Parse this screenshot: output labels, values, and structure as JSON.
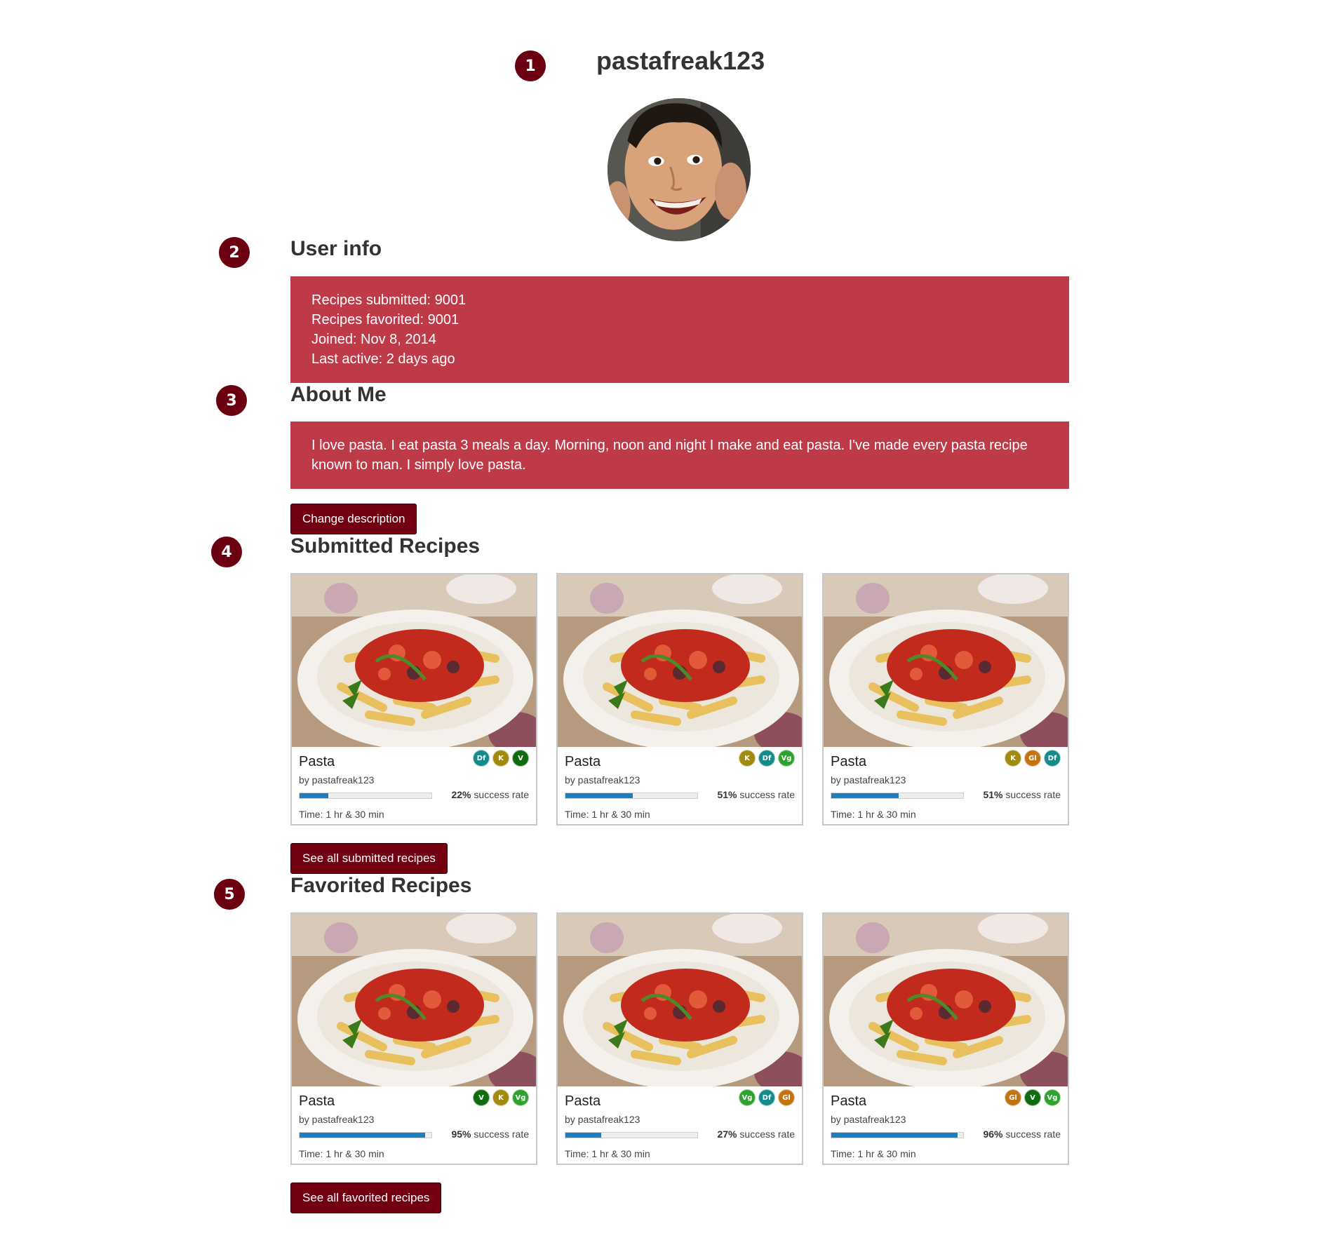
{
  "profile": {
    "username": "pastafreak123"
  },
  "markers": [
    "1",
    "2",
    "3",
    "4",
    "5"
  ],
  "user_info": {
    "heading": "User info",
    "lines": [
      "Recipes submitted: 9001",
      "Recipes favorited: 9001",
      "Joined: Nov 8, 2014",
      "Last active: 2 days ago"
    ]
  },
  "about": {
    "heading": "About Me",
    "text": "I love pasta. I eat pasta 3 meals a day. Morning, noon and night I make and eat pasta. I've made every pasta recipe known to man. I simply love pasta.",
    "change_button": "Change description"
  },
  "submitted": {
    "heading": "Submitted Recipes",
    "see_all": "See all submitted recipes",
    "cards": [
      {
        "title": "Pasta",
        "by": "by pastafreak123",
        "rate_pct": "22%",
        "rate_text": " success rate",
        "rate": 0.22,
        "time": "Time: 1 hr & 30 min",
        "badges": [
          {
            "label": "Df",
            "color": "#148a8a"
          },
          {
            "label": "K",
            "color": "#a08a10"
          },
          {
            "label": "V",
            "color": "#0e6b0e"
          }
        ]
      },
      {
        "title": "Pasta",
        "by": "by pastafreak123",
        "rate_pct": "51%",
        "rate_text": " success rate",
        "rate": 0.51,
        "time": "Time: 1 hr & 30 min",
        "badges": [
          {
            "label": "K",
            "color": "#a08a10"
          },
          {
            "label": "Df",
            "color": "#148a8a"
          },
          {
            "label": "Vg",
            "color": "#2ea12e"
          }
        ]
      },
      {
        "title": "Pasta",
        "by": "by pastafreak123",
        "rate_pct": "51%",
        "rate_text": " success rate",
        "rate": 0.51,
        "time": "Time: 1 hr & 30 min",
        "badges": [
          {
            "label": "K",
            "color": "#a08a10"
          },
          {
            "label": "Gl",
            "color": "#c27413"
          },
          {
            "label": "Df",
            "color": "#148a8a"
          }
        ]
      }
    ]
  },
  "favorited": {
    "heading": "Favorited Recipes",
    "see_all": "See all favorited recipes",
    "cards": [
      {
        "title": "Pasta",
        "by": "by pastafreak123",
        "rate_pct": "95%",
        "rate_text": " success rate",
        "rate": 0.95,
        "time": "Time: 1 hr & 30 min",
        "badges": [
          {
            "label": "V",
            "color": "#0e6b0e"
          },
          {
            "label": "K",
            "color": "#a08a10"
          },
          {
            "label": "Vg",
            "color": "#2ea12e"
          }
        ]
      },
      {
        "title": "Pasta",
        "by": "by pastafreak123",
        "rate_pct": "27%",
        "rate_text": " success rate",
        "rate": 0.27,
        "time": "Time: 1 hr & 30 min",
        "badges": [
          {
            "label": "Vg",
            "color": "#2ea12e"
          },
          {
            "label": "Df",
            "color": "#148a8a"
          },
          {
            "label": "Gl",
            "color": "#c27413"
          }
        ]
      },
      {
        "title": "Pasta",
        "by": "by pastafreak123",
        "rate_pct": "96%",
        "rate_text": " success rate",
        "rate": 0.96,
        "time": "Time: 1 hr & 30 min",
        "badges": [
          {
            "label": "Gl",
            "color": "#c27413"
          },
          {
            "label": "V",
            "color": "#0e6b0e"
          },
          {
            "label": "Vg",
            "color": "#2ea12e"
          }
        ]
      }
    ]
  },
  "colors": {
    "accent": "#730010",
    "info_background": "#bf3a48",
    "progress": "#1a7ec0"
  }
}
